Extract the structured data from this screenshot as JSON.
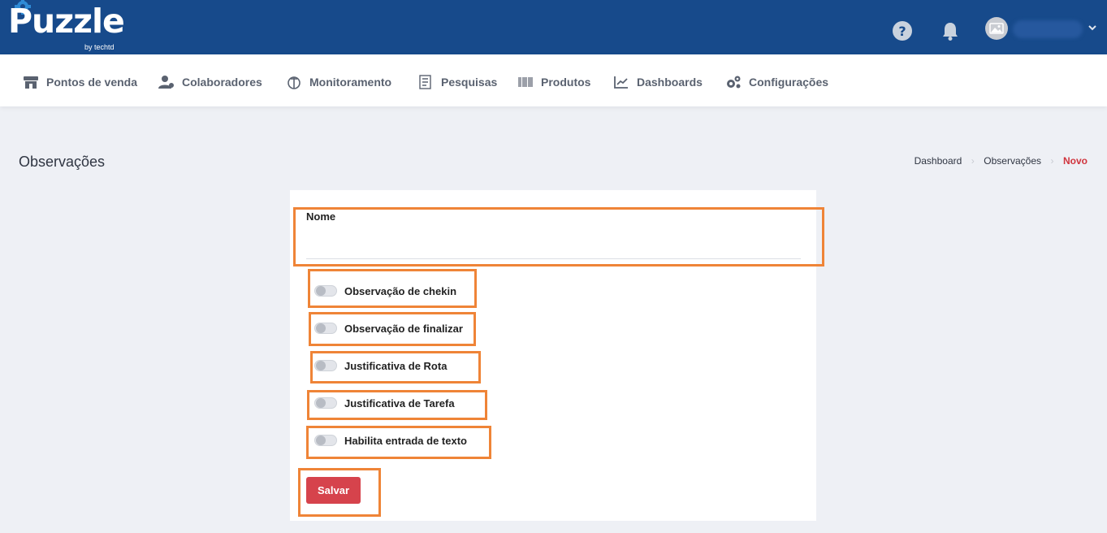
{
  "brand": {
    "name": "Puzzle",
    "tagline": "by techtd"
  },
  "header": {
    "help_icon": "question-circle-icon",
    "notification_icon": "bell-icon",
    "avatar_icon": "image-placeholder-icon",
    "menu_icon": "chevron-down-icon"
  },
  "nav": {
    "items": [
      {
        "label": "Pontos de venda",
        "icon": "store-icon"
      },
      {
        "label": "Colaboradores",
        "icon": "users-icon"
      },
      {
        "label": "Monitoramento",
        "icon": "monitor-icon"
      },
      {
        "label": "Pesquisas",
        "icon": "survey-icon"
      },
      {
        "label": "Produtos",
        "icon": "barcode-icon"
      },
      {
        "label": "Dashboards",
        "icon": "chart-line-icon"
      },
      {
        "label": "Configurações",
        "icon": "cogs-icon"
      }
    ]
  },
  "page": {
    "title": "Observações",
    "breadcrumb": [
      "Dashboard",
      "Observações",
      "Novo"
    ]
  },
  "form": {
    "name_label": "Nome",
    "name_value": "",
    "toggles": [
      {
        "label": "Observação de chekin",
        "on": false
      },
      {
        "label": "Observação de finalizar",
        "on": false
      },
      {
        "label": "Justificativa de Rota",
        "on": false
      },
      {
        "label": "Justificativa de Tarefa",
        "on": false
      },
      {
        "label": "Habilita entrada de texto",
        "on": false
      }
    ],
    "save_label": "Salvar"
  },
  "colors": {
    "topbar": "#174a8b",
    "accent": "#d6434c",
    "highlight": "#ef8437",
    "background": "#eef0f5"
  }
}
